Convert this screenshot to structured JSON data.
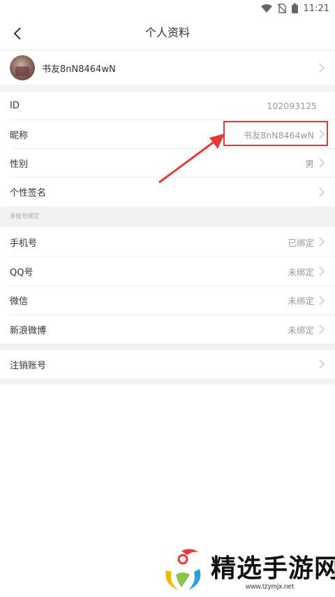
{
  "status_bar": {
    "time": "11:21"
  },
  "header": {
    "title": "个人资料"
  },
  "profile": {
    "username": "书友8nN8464wN"
  },
  "info_rows": [
    {
      "label": "ID",
      "value": "102093125",
      "has_chevron": false
    },
    {
      "label": "昵称",
      "value": "书友8nN8464wN",
      "has_chevron": true
    },
    {
      "label": "性别",
      "value": "男",
      "has_chevron": true
    },
    {
      "label": "个性签名",
      "value": "",
      "has_chevron": true
    }
  ],
  "bind_section": {
    "title": "多账号绑定",
    "rows": [
      {
        "label": "手机号",
        "value": "已绑定"
      },
      {
        "label": "QQ号",
        "value": "未绑定"
      },
      {
        "label": "微信",
        "value": "未绑定"
      },
      {
        "label": "新浪微博",
        "value": "未绑定"
      }
    ]
  },
  "cancel_account": {
    "label": "注销账号"
  },
  "watermark": {
    "brand": "精选手游网",
    "url": "www.tzymjx.net"
  },
  "colors": {
    "highlight": "#e53935",
    "divider_bg": "#f2f2f2",
    "value_text": "#999999"
  }
}
